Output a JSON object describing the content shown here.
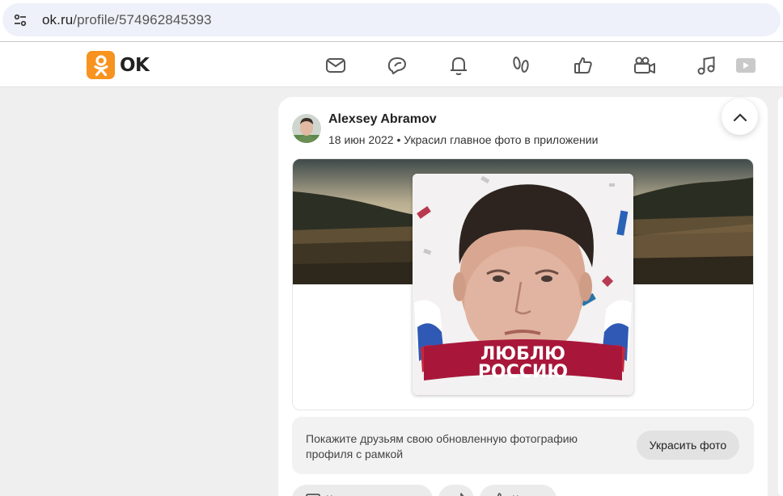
{
  "browser": {
    "url_domain": "ok.ru",
    "url_path": "/profile/574962845393"
  },
  "header": {
    "logo_text": "OK",
    "nav_icons": [
      "messages-icon",
      "discussions-icon",
      "notifications-icon",
      "guests-icon",
      "marks-icon",
      "video-icon",
      "music-icon",
      "video-play-icon"
    ]
  },
  "post": {
    "author": "Alexsey Abramov",
    "date": "18 июн 2022",
    "action": "Украсил главное фото в приложении",
    "frame_text_line1": "ЛЮБЛЮ",
    "frame_text_line2": "РОССИЮ",
    "promo_text": "Покажите друзьям свою обновленную фотографию профиля с рамкой",
    "promo_button": "Украсить фото",
    "action_1": "К",
    "action_3": "К"
  },
  "colors": {
    "ok_orange": "#f7931e",
    "ribbon_red": "#a8173a"
  }
}
